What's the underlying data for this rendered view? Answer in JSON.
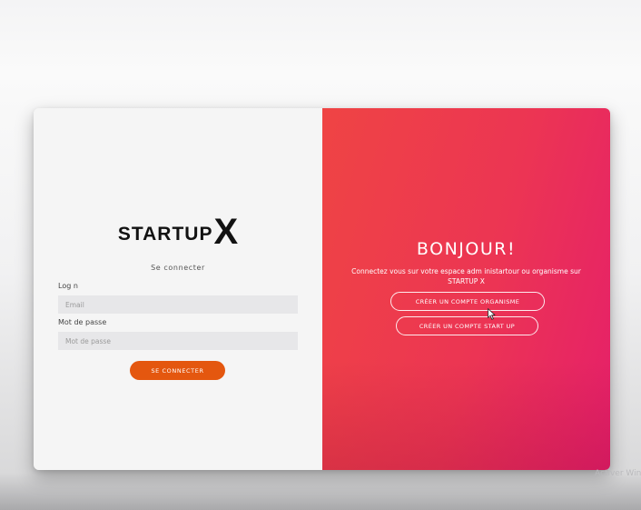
{
  "login": {
    "logo_word": "STARTUP",
    "logo_x": "X",
    "title": "Se connecter",
    "login_label": "Log n",
    "email_placeholder": "Email",
    "password_label": "Mot de passe",
    "password_placeholder": "Mot de passe",
    "submit_label": "SE CONNECTER"
  },
  "welcome": {
    "title": "BONJOUR!",
    "text": "Connectez vous sur votre espace adm inistartour ou organisme sur STARTUP X",
    "create_org_label": "CRÉER UN COMPTE ORGANISME",
    "create_startup_label": "CRÉER UN COMPTE START UP"
  },
  "watermark": "Activer Win",
  "colors": {
    "accent_orange": "#e4570f",
    "gradient_start": "#ef4444",
    "gradient_end": "#e51f6a"
  },
  "icons": [
    "mouse-cursor-icon"
  ]
}
